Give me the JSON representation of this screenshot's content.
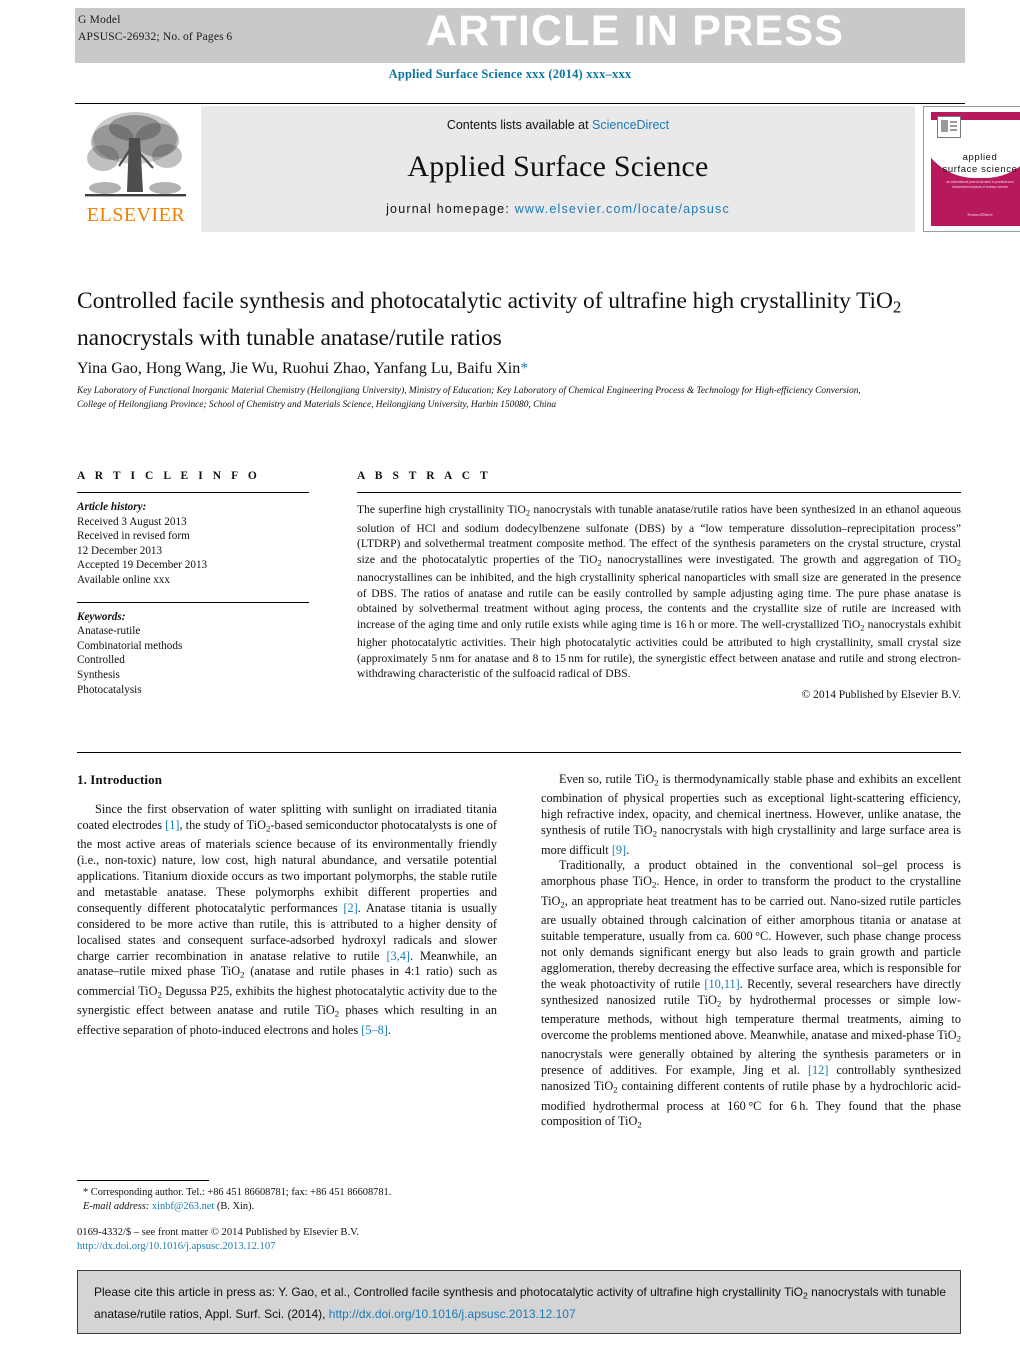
{
  "banner": {
    "g_model": "G Model",
    "article_number": "APSUSC-26932;   No. of Pages 6",
    "in_press_label": "ARTICLE IN PRESS"
  },
  "journal_ref": "Applied Surface Science xxx (2014) xxx–xxx",
  "masthead": {
    "contents_prefix": "Contents lists available at ",
    "sciencedirect": "ScienceDirect",
    "journal_name": "Applied Surface Science",
    "homepage_label": "journal homepage: ",
    "homepage_url": "www.elsevier.com/locate/apsusc",
    "publisher": "ELSEVIER",
    "cover_title_line1": "applied",
    "cover_title_line2": "surface science",
    "cover_sub": "an international journal devoted to practical and fundamental aspects of surface science",
    "cover_foot": "ScienceDirect"
  },
  "article": {
    "title": "Controlled facile synthesis and photocatalytic activity of ultrafine high crystallinity TiO2 nanocrystals with tunable anatase/rutile ratios",
    "authors": "Yina Gao, Hong Wang, Jie Wu, Ruohui Zhao, Yanfang Lu, Baifu Xin",
    "corresponding_marker": "*",
    "affiliation": "Key Laboratory of Functional Inorganic Material Chemistry (Heilongjiang University), Ministry of Education; Key Laboratory of Chemical Engineering Process & Technology for High-efficiency Conversion, College of Heilongjiang Province; School of Chemistry and Materials Science, Heilongjiang University, Harbin 150080, China"
  },
  "article_info": {
    "heading": "A R T I C L E   I N F O",
    "history_label": "Article history:",
    "history": [
      "Received 3 August 2013",
      "Received in revised form",
      "12 December 2013",
      "Accepted 19 December 2013",
      "Available online xxx"
    ],
    "keywords_label": "Keywords:",
    "keywords": [
      "Anatase-rutile",
      "Combinatorial methods",
      "Controlled",
      "Synthesis",
      "Photocatalysis"
    ]
  },
  "abstract": {
    "heading": "A B S T R A C T",
    "text": "The superfine high crystallinity TiO2 nanocrystals with tunable anatase/rutile ratios have been synthesized in an ethanol aqueous solution of HCl and sodium dodecylbenzene sulfonate (DBS) by a “low temperature dissolution–reprecipitation process” (LTDRP) and solvethermal treatment composite method. The effect of the synthesis parameters on the crystal structure, crystal size and the photocatalytic properties of the TiO2 nanocrystallines were investigated. The growth and aggregation of TiO2 nanocrystallines can be inhibited, and the high crystallinity spherical nanoparticles with small size are generated in the presence of DBS. The ratios of anatase and rutile can be easily controlled by sample adjusting aging time. The pure phase anatase is obtained by solvethermal treatment without aging process, the contents and the crystallite size of rutile are increased with increase of the aging time and only rutile exists while aging time is 16 h or more. The well-crystallized TiO2 nanocrystals exhibit higher photocatalytic activities. Their high photocatalytic activities could be attributed to high crystallinity, small crystal size (approximately 5 nm for anatase and 8 to 15 nm for rutile), the synergistic effect between anatase and rutile and strong electron-withdrawing characteristic of the sulfoacid radical of DBS.",
    "copyright": "© 2014 Published by Elsevier B.V."
  },
  "sections": {
    "intro_heading": "1.  Introduction",
    "left_paragraphs": [
      "Since the first observation of water splitting with sunlight on irradiated titania coated electrodes [1], the study of TiO2-based semiconductor photocatalysts is one of the most active areas of materials science because of its environmentally friendly (i.e., non-toxic) nature, low cost, high natural abundance, and versatile potential applications. Titanium dioxide occurs as two important polymorphs, the stable rutile and metastable anatase. These polymorphs exhibit different properties and consequently different photocatalytic performances [2]. Anatase titania is usually considered to be more active than rutile, this is attributed to a higher density of localised states and consequent surface-adsorbed hydroxyl radicals and slower charge carrier recombination in anatase relative to rutile [3,4]. Meanwhile, an anatase–rutile mixed phase TiO2 (anatase and rutile phases in 4:1 ratio) such as commercial TiO2 Degussa P25, exhibits the highest photocatalytic activity due to the synergistic effect between anatase and rutile TiO2 phases which resulting in an effective separation of photo-induced electrons and holes [5–8]."
    ],
    "right_paragraphs": [
      "Even so, rutile TiO2 is thermodynamically stable phase and exhibits an excellent combination of physical properties such as exceptional light-scattering efficiency, high refractive index, opacity, and chemical inertness. However, unlike anatase, the synthesis of rutile TiO2 nanocrystals with high crystallinity and large surface area is more difficult [9].",
      "Traditionally, a product obtained in the conventional sol–gel process is amorphous phase TiO2. Hence, in order to transform the product to the crystalline TiO2, an appropriate heat treatment has to be carried out. Nano-sized rutile particles are usually obtained through calcination of either amorphous titania or anatase at suitable temperature, usually from ca. 600 °C. However, such phase change process not only demands significant energy but also leads to grain growth and particle agglomeration, thereby decreasing the effective surface area, which is responsible for the weak photoactivity of rutile [10,11]. Recently, several researchers have directly synthesized nanosized rutile TiO2 by hydrothermal processes or simple low-temperature methods, without high temperature thermal treatments, aiming to overcome the problems mentioned above. Meanwhile, anatase and mixed-phase TiO2 nanocrystals were generally obtained by altering the synthesis parameters or in presence of additives. For example, Jing et al. [12] controllably synthesized nanosized TiO2 containing different contents of rutile phase by a hydrochloric acid-modified hydrothermal process at 160 °C for 6 h. They found that the phase composition of TiO2"
    ]
  },
  "footnote": {
    "corresponding": "* Corresponding author. Tel.: +86 451 86608781; fax: +86 451 86608781.",
    "email_label": "E-mail address:",
    "email": "xinbf@263.net",
    "email_owner": "(B. Xin)."
  },
  "issn_line": {
    "text": "0169-4332/$ – see front matter © 2014 Published by Elsevier B.V.",
    "doi": "http://dx.doi.org/10.1016/j.apsusc.2013.12.107"
  },
  "cite_box": {
    "prefix": "Please cite this article in press as: Y. Gao, et al., Controlled facile synthesis and photocatalytic activity of ultrafine high crystallinity TiO",
    "sub1": "2",
    "middle": " nanocrystals with tunable anatase/rutile ratios, Appl. Surf. Sci. (2014), ",
    "doi": "http://dx.doi.org/10.1016/j.apsusc.2013.12.107"
  },
  "colors": {
    "link_blue": "#1c7bb5",
    "journal_blue": "#0b76a0",
    "elsevier_orange": "#f08000",
    "banner_gray": "#c9c9c9",
    "cover_crimson": "#b8185c",
    "cite_box_gray": "#d4d4d4"
  }
}
